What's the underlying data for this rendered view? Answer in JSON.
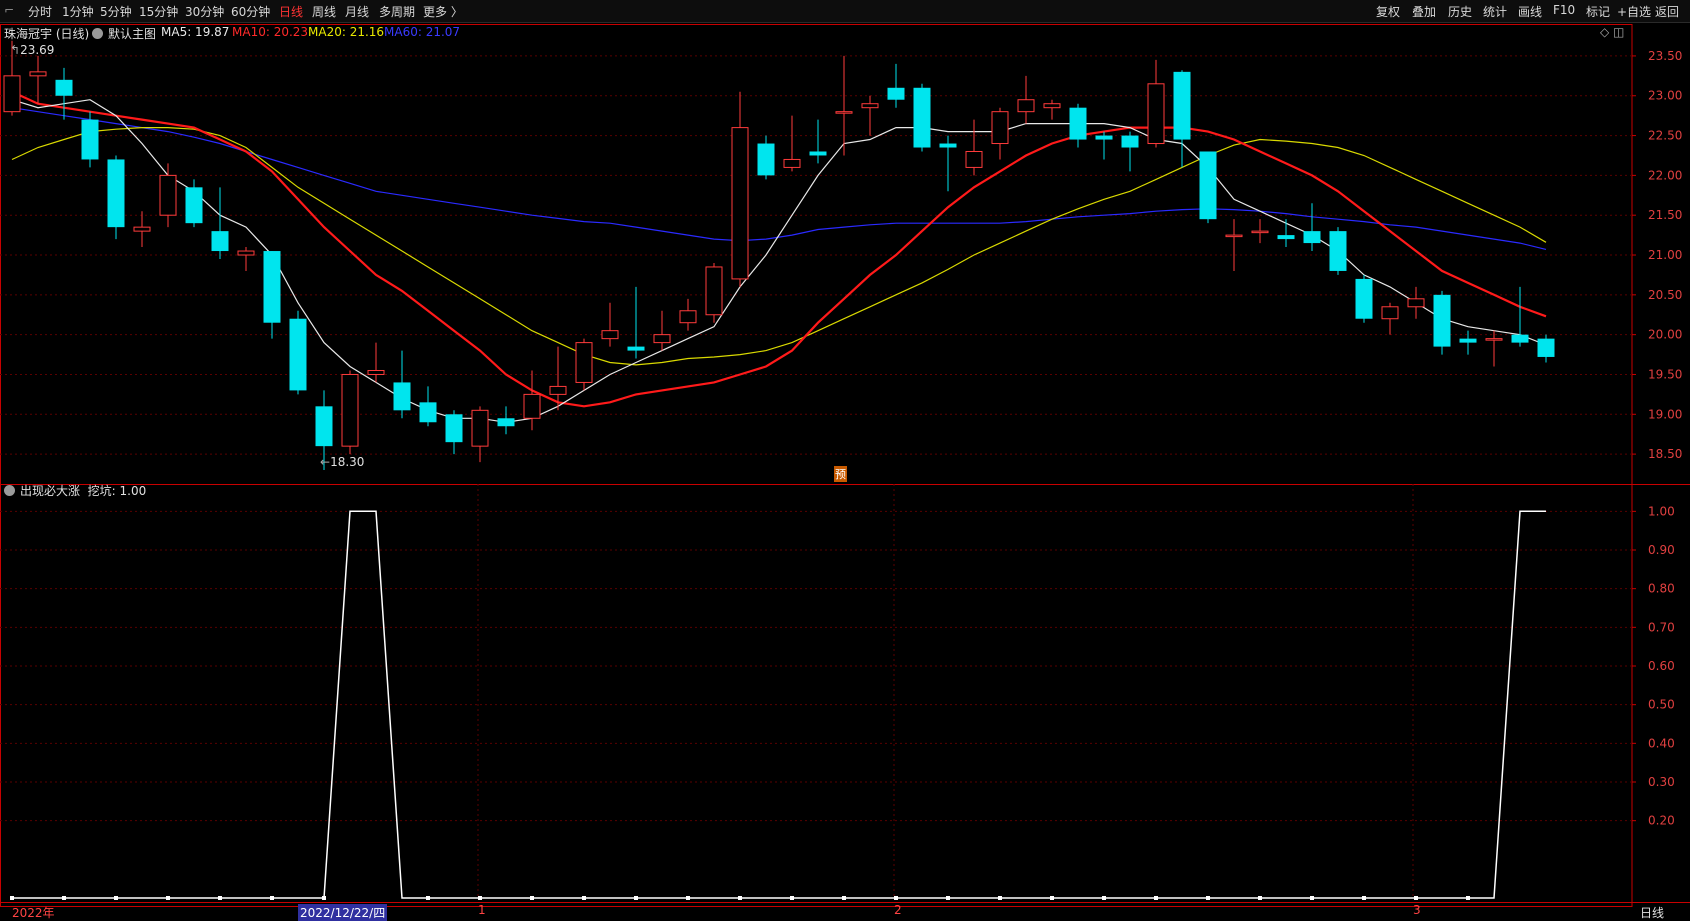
{
  "toolbar": {
    "left": [
      "分时",
      "1分钟",
      "5分钟",
      "15分钟",
      "30分钟",
      "60分钟",
      "日线",
      "周线",
      "月线",
      "多周期",
      "更多 〉"
    ],
    "active": "日线",
    "right": [
      "复权",
      "叠加",
      "历史",
      "统计",
      "画线",
      "F10",
      "标记",
      "+自选",
      "返回"
    ]
  },
  "main_legend": {
    "stock": "珠海冠宇 (日线)",
    "template": "默认主图",
    "ma5": "MA5: 19.87",
    "ma10": "MA10: 20.23",
    "ma20": "MA20: 21.16",
    "ma60": "MA60: 21.07"
  },
  "indicator_legend": {
    "name": "出现必大涨",
    "value": "挖坑: 1.00"
  },
  "annotations": {
    "high": "23.69",
    "low": "18.30",
    "pre": "预"
  },
  "date_labels": {
    "year": "2022年",
    "cursor": "2022/12/22/四",
    "jan": "1",
    "feb": "2",
    "mar": "3",
    "period": "日线"
  },
  "colors": {
    "up": "#ff3b3b",
    "down": "#00e5ee",
    "ma5": "#e8e8e8",
    "ma10": "#ff1a1a",
    "ma20": "#d9d900",
    "ma60": "#2a2aff",
    "grid": "#5a0000",
    "axis": "#c80000"
  },
  "chart_data": [
    {
      "type": "candlestick",
      "ylim": [
        18.2,
        23.7
      ],
      "yticks": [
        "23.50",
        "23.00",
        "22.50",
        "22.00",
        "21.50",
        "21.00",
        "20.50",
        "20.00",
        "19.50",
        "19.00",
        "18.50"
      ],
      "candles": [
        {
          "o": 22.8,
          "c": 23.25,
          "h": 23.69,
          "l": 22.75
        },
        {
          "o": 23.25,
          "c": 23.3,
          "h": 23.5,
          "l": 22.9
        },
        {
          "o": 23.2,
          "c": 23.0,
          "h": 23.35,
          "l": 22.7
        },
        {
          "o": 22.7,
          "c": 22.2,
          "h": 22.8,
          "l": 22.1
        },
        {
          "o": 22.2,
          "c": 21.35,
          "h": 22.25,
          "l": 21.2
        },
        {
          "o": 21.3,
          "c": 21.35,
          "h": 21.55,
          "l": 21.1
        },
        {
          "o": 21.5,
          "c": 22.0,
          "h": 22.15,
          "l": 21.35
        },
        {
          "o": 21.85,
          "c": 21.4,
          "h": 21.95,
          "l": 21.35
        },
        {
          "o": 21.3,
          "c": 21.05,
          "h": 21.85,
          "l": 20.95
        },
        {
          "o": 21.0,
          "c": 21.05,
          "h": 21.1,
          "l": 20.8
        },
        {
          "o": 21.05,
          "c": 20.15,
          "h": 21.05,
          "l": 19.95
        },
        {
          "o": 20.2,
          "c": 19.3,
          "h": 20.3,
          "l": 19.25
        },
        {
          "o": 19.1,
          "c": 18.6,
          "h": 19.3,
          "l": 18.3
        },
        {
          "o": 18.6,
          "c": 19.5,
          "h": 19.55,
          "l": 18.5
        },
        {
          "o": 19.5,
          "c": 19.55,
          "h": 19.9,
          "l": 19.4
        },
        {
          "o": 19.4,
          "c": 19.05,
          "h": 19.8,
          "l": 18.95
        },
        {
          "o": 19.15,
          "c": 18.9,
          "h": 19.35,
          "l": 18.85
        },
        {
          "o": 19.0,
          "c": 18.65,
          "h": 19.05,
          "l": 18.5
        },
        {
          "o": 18.6,
          "c": 19.05,
          "h": 19.1,
          "l": 18.4
        },
        {
          "o": 18.95,
          "c": 18.85,
          "h": 19.1,
          "l": 18.75
        },
        {
          "o": 18.95,
          "c": 19.25,
          "h": 19.55,
          "l": 18.8
        },
        {
          "o": 19.25,
          "c": 19.35,
          "h": 19.85,
          "l": 19.05
        },
        {
          "o": 19.4,
          "c": 19.9,
          "h": 19.95,
          "l": 19.3
        },
        {
          "o": 19.95,
          "c": 20.05,
          "h": 20.4,
          "l": 19.85
        },
        {
          "o": 19.85,
          "c": 19.8,
          "h": 20.6,
          "l": 19.7
        },
        {
          "o": 19.9,
          "c": 20.0,
          "h": 20.3,
          "l": 19.8
        },
        {
          "o": 20.15,
          "c": 20.3,
          "h": 20.45,
          "l": 20.05
        },
        {
          "o": 20.25,
          "c": 20.85,
          "h": 20.9,
          "l": 20.15
        },
        {
          "o": 20.7,
          "c": 22.6,
          "h": 23.05,
          "l": 20.6
        },
        {
          "o": 22.4,
          "c": 22.0,
          "h": 22.5,
          "l": 21.95
        },
        {
          "o": 22.1,
          "c": 22.2,
          "h": 22.75,
          "l": 22.05
        },
        {
          "o": 22.3,
          "c": 22.25,
          "h": 22.7,
          "l": 22.15
        },
        {
          "o": 22.8,
          "c": 22.8,
          "h": 23.5,
          "l": 22.25
        },
        {
          "o": 22.85,
          "c": 22.9,
          "h": 23.0,
          "l": 22.5
        },
        {
          "o": 23.1,
          "c": 22.95,
          "h": 23.4,
          "l": 22.85
        },
        {
          "o": 23.1,
          "c": 22.35,
          "h": 23.15,
          "l": 22.3
        },
        {
          "o": 22.4,
          "c": 22.35,
          "h": 22.5,
          "l": 21.8
        },
        {
          "o": 22.1,
          "c": 22.3,
          "h": 22.7,
          "l": 22.0
        },
        {
          "o": 22.4,
          "c": 22.8,
          "h": 22.85,
          "l": 22.2
        },
        {
          "o": 22.8,
          "c": 22.95,
          "h": 23.25,
          "l": 22.65
        },
        {
          "o": 22.85,
          "c": 22.9,
          "h": 22.95,
          "l": 22.7
        },
        {
          "o": 22.85,
          "c": 22.45,
          "h": 22.9,
          "l": 22.35
        },
        {
          "o": 22.5,
          "c": 22.45,
          "h": 22.55,
          "l": 22.2
        },
        {
          "o": 22.5,
          "c": 22.35,
          "h": 22.55,
          "l": 22.05
        },
        {
          "o": 22.4,
          "c": 23.15,
          "h": 23.45,
          "l": 22.35
        },
        {
          "o": 23.3,
          "c": 22.45,
          "h": 23.32,
          "l": 22.1
        },
        {
          "o": 22.3,
          "c": 21.45,
          "h": 22.3,
          "l": 21.4
        },
        {
          "o": 21.25,
          "c": 21.25,
          "h": 21.45,
          "l": 20.8
        },
        {
          "o": 21.3,
          "c": 21.3,
          "h": 21.45,
          "l": 21.15
        },
        {
          "o": 21.25,
          "c": 21.2,
          "h": 21.45,
          "l": 21.1
        },
        {
          "o": 21.3,
          "c": 21.15,
          "h": 21.65,
          "l": 21.05
        },
        {
          "o": 21.3,
          "c": 20.8,
          "h": 21.35,
          "l": 20.75
        },
        {
          "o": 20.7,
          "c": 20.2,
          "h": 20.75,
          "l": 20.15
        },
        {
          "o": 20.2,
          "c": 20.35,
          "h": 20.4,
          "l": 20.0
        },
        {
          "o": 20.35,
          "c": 20.45,
          "h": 20.6,
          "l": 20.2
        },
        {
          "o": 20.5,
          "c": 19.85,
          "h": 20.55,
          "l": 19.75
        },
        {
          "o": 19.95,
          "c": 19.9,
          "h": 20.05,
          "l": 19.75
        },
        {
          "o": 19.95,
          "c": 19.95,
          "h": 20.05,
          "l": 19.6
        },
        {
          "o": 20.0,
          "c": 19.9,
          "h": 20.6,
          "l": 19.85
        },
        {
          "o": 19.95,
          "c": 19.72,
          "h": 20.0,
          "l": 19.65
        }
      ],
      "ma5": [
        22.95,
        22.85,
        22.9,
        22.95,
        22.75,
        22.4,
        22.0,
        21.8,
        21.5,
        21.35,
        21.0,
        20.4,
        19.9,
        19.6,
        19.4,
        19.2,
        19.05,
        18.95,
        18.95,
        18.9,
        18.95,
        19.1,
        19.3,
        19.5,
        19.65,
        19.8,
        19.95,
        20.1,
        20.6,
        21.0,
        21.5,
        22.0,
        22.4,
        22.45,
        22.6,
        22.6,
        22.55,
        22.55,
        22.55,
        22.65,
        22.65,
        22.65,
        22.65,
        22.6,
        22.45,
        22.4,
        22.1,
        21.7,
        21.55,
        21.4,
        21.25,
        21.05,
        20.75,
        20.6,
        20.4,
        20.2,
        20.1,
        20.05,
        20.0,
        19.87
      ],
      "ma10": [
        23.05,
        22.9,
        22.85,
        22.8,
        22.75,
        22.7,
        22.65,
        22.6,
        22.45,
        22.3,
        22.05,
        21.7,
        21.35,
        21.05,
        20.75,
        20.55,
        20.3,
        20.05,
        19.8,
        19.5,
        19.3,
        19.15,
        19.1,
        19.15,
        19.25,
        19.3,
        19.35,
        19.4,
        19.5,
        19.6,
        19.8,
        20.15,
        20.45,
        20.75,
        21.0,
        21.3,
        21.6,
        21.85,
        22.05,
        22.25,
        22.4,
        22.5,
        22.55,
        22.6,
        22.6,
        22.6,
        22.55,
        22.45,
        22.3,
        22.15,
        22.0,
        21.8,
        21.55,
        21.3,
        21.05,
        20.8,
        20.65,
        20.5,
        20.35,
        20.23
      ],
      "ma20": [
        22.2,
        22.35,
        22.45,
        22.55,
        22.58,
        22.6,
        22.6,
        22.58,
        22.5,
        22.35,
        22.1,
        21.85,
        21.65,
        21.45,
        21.25,
        21.05,
        20.85,
        20.65,
        20.45,
        20.25,
        20.05,
        19.9,
        19.75,
        19.65,
        19.62,
        19.65,
        19.7,
        19.72,
        19.75,
        19.8,
        19.9,
        20.05,
        20.2,
        20.35,
        20.5,
        20.65,
        20.82,
        21.0,
        21.15,
        21.3,
        21.45,
        21.58,
        21.7,
        21.8,
        21.95,
        22.1,
        22.25,
        22.38,
        22.45,
        22.43,
        22.4,
        22.35,
        22.25,
        22.1,
        21.95,
        21.8,
        21.65,
        21.5,
        21.35,
        21.16
      ],
      "ma60": [
        22.85,
        22.8,
        22.75,
        22.7,
        22.65,
        22.6,
        22.55,
        22.48,
        22.4,
        22.3,
        22.2,
        22.1,
        22.0,
        21.9,
        21.8,
        21.75,
        21.7,
        21.65,
        21.6,
        21.55,
        21.5,
        21.46,
        21.42,
        21.4,
        21.35,
        21.3,
        21.25,
        21.2,
        21.18,
        21.2,
        21.25,
        21.32,
        21.35,
        21.38,
        21.4,
        21.4,
        21.4,
        21.4,
        21.4,
        21.42,
        21.45,
        21.48,
        21.5,
        21.52,
        21.55,
        21.57,
        21.58,
        21.57,
        21.55,
        21.52,
        21.48,
        21.45,
        21.42,
        21.38,
        21.35,
        21.3,
        21.25,
        21.2,
        21.15,
        21.07
      ]
    },
    {
      "type": "line",
      "ylim": [
        0,
        1.05
      ],
      "yticks": [
        "1.00",
        "0.90",
        "0.80",
        "0.70",
        "0.60",
        "0.50",
        "0.40",
        "0.30",
        "0.20"
      ],
      "values": [
        0,
        0,
        0,
        0,
        0,
        0,
        0,
        0,
        0,
        0,
        0,
        0,
        0,
        1,
        1,
        0,
        0,
        0,
        0,
        0,
        0,
        0,
        0,
        0,
        0,
        0,
        0,
        0,
        0,
        0,
        0,
        0,
        0,
        0,
        0,
        0,
        0,
        0,
        0,
        0,
        0,
        0,
        0,
        0,
        0,
        0,
        0,
        0,
        0,
        0,
        0,
        0,
        0,
        0,
        0,
        0,
        0,
        0,
        1,
        1
      ]
    }
  ]
}
